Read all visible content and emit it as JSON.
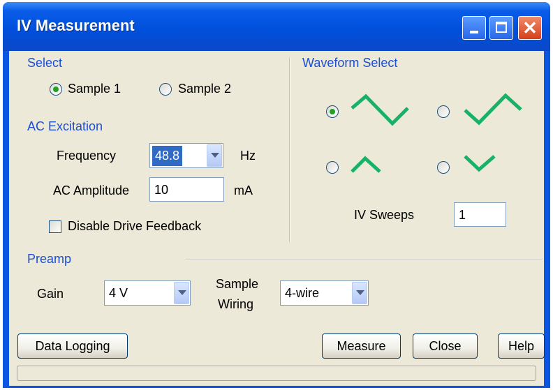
{
  "window": {
    "title": "IV Measurement"
  },
  "select": {
    "label": "Select",
    "sample1": "Sample 1",
    "sample2": "Sample 2",
    "selected": "Sample 1"
  },
  "ac_excitation": {
    "label": "AC Excitation",
    "frequency_label": "Frequency",
    "frequency_value": "48.8",
    "frequency_unit": "Hz",
    "amplitude_label": "AC Amplitude",
    "amplitude_value": "10",
    "amplitude_unit": "mA",
    "disable_feedback_label": "Disable Drive Feedback",
    "disable_feedback_checked": false
  },
  "waveform": {
    "label": "Waveform Select",
    "options": [
      "full-cycle-valley",
      "full-cycle-peak",
      "half-cycle-peak",
      "half-cycle-valley"
    ],
    "selected_index": 0,
    "wave_color": "#17b169",
    "sweeps_label": "IV Sweeps",
    "sweeps_value": "1"
  },
  "preamp": {
    "label": "Preamp",
    "gain_label": "Gain",
    "gain_value": "4 V",
    "wiring_label_line1": "Sample",
    "wiring_label_line2": "Wiring",
    "wiring_value": "4-wire"
  },
  "buttons": {
    "data_logging": "Data Logging",
    "measure": "Measure",
    "close": "Close",
    "help": "Help"
  },
  "titlebar_buttons": {
    "close_glyph": "✕"
  }
}
